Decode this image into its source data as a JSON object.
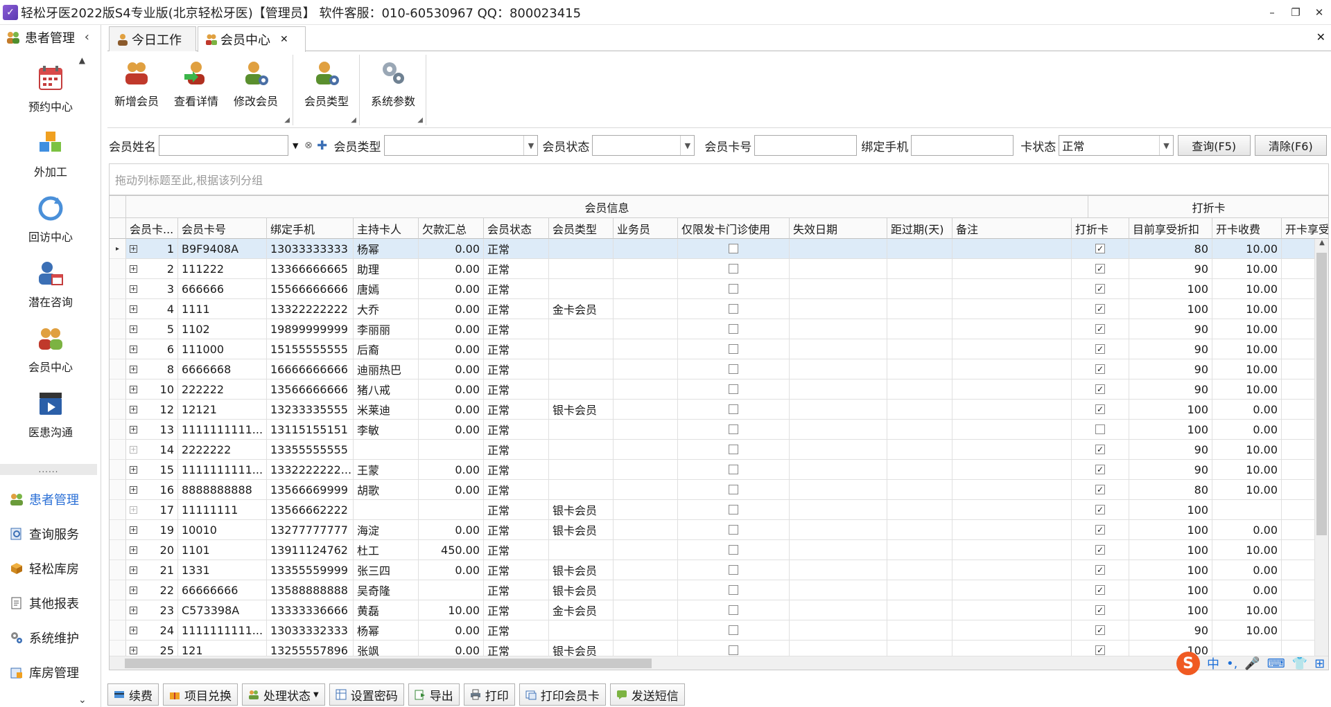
{
  "window": {
    "title": "轻松牙医2022版S4专业版(北京轻松牙医)【管理员】   软件客服：010-60530967 QQ：800023415",
    "controls": [
      "–",
      "❐",
      "✕"
    ]
  },
  "sidebar": {
    "header": "患者管理",
    "big_items": [
      {
        "label": "预约中心",
        "icon": "calendar-icon"
      },
      {
        "label": "外加工",
        "icon": "cubes-icon"
      },
      {
        "label": "回访中心",
        "icon": "refresh-icon"
      },
      {
        "label": "潜在咨询",
        "icon": "person-calendar-icon"
      },
      {
        "label": "会员中心",
        "icon": "members-icon"
      },
      {
        "label": "医患沟通",
        "icon": "clapper-icon"
      }
    ],
    "small_items": [
      {
        "label": "患者管理",
        "icon": "people-icon",
        "active": true
      },
      {
        "label": "查询服务",
        "icon": "search-doc-icon",
        "active": false
      },
      {
        "label": "轻松库房",
        "icon": "box-icon",
        "active": false
      },
      {
        "label": "其他报表",
        "icon": "report-icon",
        "active": false
      },
      {
        "label": "系统维护",
        "icon": "gears-icon",
        "active": false
      },
      {
        "label": "库房管理",
        "icon": "warehouse-icon",
        "active": false
      }
    ],
    "splitter": "......"
  },
  "tabs": [
    {
      "label": "今日工作",
      "active": false
    },
    {
      "label": "会员中心",
      "active": true,
      "closable": true
    }
  ],
  "ribbon": {
    "group1": [
      "新增会员",
      "查看详情",
      "修改会员"
    ],
    "group2": [
      "会员类型"
    ],
    "group3": [
      "系统参数"
    ]
  },
  "filters": {
    "member_name_label": "会员姓名",
    "member_name_value": "",
    "member_type_label": "会员类型",
    "member_type_value": "",
    "member_status_label": "会员状态",
    "member_status_value": "",
    "card_no_label": "会员卡号",
    "card_no_value": "",
    "phone_label": "绑定手机",
    "phone_value": "",
    "card_status_label": "卡状态",
    "card_status_value": "正常",
    "query_button": "查询(F5)",
    "clear_button": "清除(F6)"
  },
  "grid": {
    "group_hint": "拖动列标题至此,根据该列分组",
    "bands": {
      "info": "会员信息",
      "discount": "打折卡"
    },
    "columns": [
      "会员卡...",
      "会员卡号",
      "绑定手机",
      "主持卡人",
      "欠款汇总",
      "会员状态",
      "会员类型",
      "业务员",
      "仅限发卡门诊使用",
      "失效日期",
      "距过期(天)",
      "备注",
      "打折卡",
      "目前享受折扣",
      "开卡收费",
      "开卡享受"
    ],
    "rows": [
      {
        "id": "1",
        "card": "B9F9408A",
        "phone": "13033333333",
        "holder": "杨幂",
        "debt": "0.00",
        "status": "正常",
        "type": "",
        "disc_card": true,
        "discount": "80",
        "fee": "10.00",
        "expand_light": false
      },
      {
        "id": "2",
        "card": "111222",
        "phone": "13366666665",
        "holder": "助理",
        "debt": "0.00",
        "status": "正常",
        "type": "",
        "disc_card": true,
        "discount": "90",
        "fee": "10.00",
        "expand_light": false
      },
      {
        "id": "3",
        "card": "666666",
        "phone": "15566666666",
        "holder": "唐嫣",
        "debt": "0.00",
        "status": "正常",
        "type": "",
        "disc_card": true,
        "discount": "100",
        "fee": "10.00",
        "expand_light": false
      },
      {
        "id": "4",
        "card": "1111",
        "phone": "13322222222",
        "holder": "大乔",
        "debt": "0.00",
        "status": "正常",
        "type": "金卡会员",
        "disc_card": true,
        "discount": "100",
        "fee": "10.00",
        "expand_light": false
      },
      {
        "id": "5",
        "card": "1102",
        "phone": "19899999999",
        "holder": "李丽丽",
        "debt": "0.00",
        "status": "正常",
        "type": "",
        "disc_card": true,
        "discount": "90",
        "fee": "10.00",
        "expand_light": false
      },
      {
        "id": "6",
        "card": "111000",
        "phone": "15155555555",
        "holder": "后裔",
        "debt": "0.00",
        "status": "正常",
        "type": "",
        "disc_card": true,
        "discount": "90",
        "fee": "10.00",
        "expand_light": false
      },
      {
        "id": "8",
        "card": "6666668",
        "phone": "16666666666",
        "holder": "迪丽热巴",
        "debt": "0.00",
        "status": "正常",
        "type": "",
        "disc_card": true,
        "discount": "90",
        "fee": "10.00",
        "expand_light": false
      },
      {
        "id": "10",
        "card": "222222",
        "phone": "13566666666",
        "holder": "猪八戒",
        "debt": "0.00",
        "status": "正常",
        "type": "",
        "disc_card": true,
        "discount": "90",
        "fee": "10.00",
        "expand_light": false
      },
      {
        "id": "12",
        "card": "12121",
        "phone": "13233335555",
        "holder": "米莱迪",
        "debt": "0.00",
        "status": "正常",
        "type": "银卡会员",
        "disc_card": true,
        "discount": "100",
        "fee": "0.00",
        "expand_light": false
      },
      {
        "id": "13",
        "card": "1111111111...",
        "phone": "13115155151",
        "holder": "李敏",
        "debt": "0.00",
        "status": "正常",
        "type": "",
        "disc_card": false,
        "discount": "100",
        "fee": "0.00",
        "expand_light": false
      },
      {
        "id": "14",
        "card": "2222222",
        "phone": "13355555555",
        "holder": "",
        "debt": "",
        "status": "正常",
        "type": "",
        "disc_card": true,
        "discount": "90",
        "fee": "10.00",
        "expand_light": true
      },
      {
        "id": "15",
        "card": "1111111111...",
        "phone": "1332222222...",
        "holder": "王蒙",
        "debt": "0.00",
        "status": "正常",
        "type": "",
        "disc_card": true,
        "discount": "90",
        "fee": "10.00",
        "expand_light": false
      },
      {
        "id": "16",
        "card": "8888888888",
        "phone": "13566669999",
        "holder": "胡歌",
        "debt": "0.00",
        "status": "正常",
        "type": "",
        "disc_card": true,
        "discount": "80",
        "fee": "10.00",
        "expand_light": false
      },
      {
        "id": "17",
        "card": "11111111",
        "phone": "13566662222",
        "holder": "",
        "debt": "",
        "status": "正常",
        "type": "银卡会员",
        "disc_card": true,
        "discount": "100",
        "fee": "",
        "expand_light": true
      },
      {
        "id": "19",
        "card": "10010",
        "phone": "13277777777",
        "holder": "海淀",
        "debt": "0.00",
        "status": "正常",
        "type": "银卡会员",
        "disc_card": true,
        "discount": "100",
        "fee": "0.00",
        "expand_light": false
      },
      {
        "id": "20",
        "card": "1101",
        "phone": "13911124762",
        "holder": "杜工",
        "debt": "450.00",
        "status": "正常",
        "type": "",
        "disc_card": true,
        "discount": "100",
        "fee": "10.00",
        "expand_light": false
      },
      {
        "id": "21",
        "card": "1331",
        "phone": "13355559999",
        "holder": "张三四",
        "debt": "0.00",
        "status": "正常",
        "type": "银卡会员",
        "disc_card": true,
        "discount": "100",
        "fee": "0.00",
        "expand_light": false
      },
      {
        "id": "22",
        "card": "66666666",
        "phone": "13588888888",
        "holder": "吴奇隆",
        "debt": "",
        "status": "正常",
        "type": "银卡会员",
        "disc_card": true,
        "discount": "100",
        "fee": "0.00",
        "expand_light": false
      },
      {
        "id": "23",
        "card": "C573398A",
        "phone": "13333336666",
        "holder": "黄磊",
        "debt": "10.00",
        "status": "正常",
        "type": "金卡会员",
        "disc_card": true,
        "discount": "100",
        "fee": "10.00",
        "expand_light": false
      },
      {
        "id": "24",
        "card": "1111111111...",
        "phone": "13033332333",
        "holder": "杨幂",
        "debt": "0.00",
        "status": "正常",
        "type": "",
        "disc_card": true,
        "discount": "90",
        "fee": "10.00",
        "expand_light": false
      },
      {
        "id": "25",
        "card": "121",
        "phone": "13255557896",
        "holder": "张飒",
        "debt": "0.00",
        "status": "正常",
        "type": "银卡会员",
        "disc_card": true,
        "discount": "100",
        "fee": "",
        "expand_light": false
      }
    ]
  },
  "bottom_toolbar": [
    "续费",
    "项目兑换",
    "处理状态",
    "设置密码",
    "导出",
    "打印",
    "打印会员卡",
    "发送短信"
  ],
  "ime": {
    "logo": "S",
    "items": [
      "中",
      "•,",
      "🎤",
      "⌨",
      "👕",
      "⊞"
    ]
  },
  "colors": {
    "accent": "#2a6fd6",
    "selected_row": "#ddebf8"
  }
}
